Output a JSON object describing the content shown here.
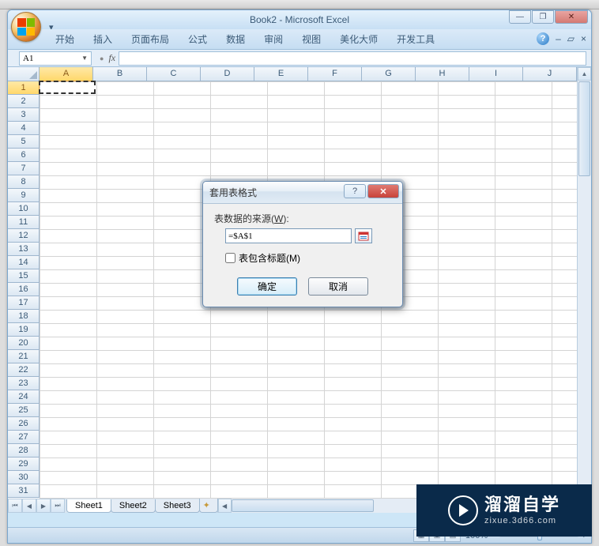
{
  "app": {
    "title": "Book2 - Microsoft Excel"
  },
  "ribbon": {
    "tabs": [
      "开始",
      "插入",
      "页面布局",
      "公式",
      "数据",
      "审阅",
      "视图",
      "美化大师",
      "开发工具"
    ]
  },
  "nameBox": "A1",
  "fx": "fx",
  "columns": [
    "A",
    "B",
    "C",
    "D",
    "E",
    "F",
    "G",
    "H",
    "I",
    "J"
  ],
  "rowCount": 31,
  "sheets": {
    "s1": "Sheet1",
    "s2": "Sheet2",
    "s3": "Sheet3"
  },
  "dialog": {
    "title": "套用表格式",
    "sourceLabel": "表数据的来源",
    "sourceKey": "(W)",
    "colon": ":",
    "refValue": "=$A$1",
    "headerCheck": "表包含标题",
    "headerKey": "(M)",
    "ok": "确定",
    "cancel": "取消",
    "help": "?",
    "close": "✕"
  },
  "zoom": {
    "value": "100%",
    "minus": "−",
    "plus": "+"
  },
  "watermark": {
    "cn": "溜溜自学",
    "en": "zixue.3d66.com"
  },
  "winControls": {
    "min": "—",
    "max": "❐",
    "close": "✕"
  }
}
